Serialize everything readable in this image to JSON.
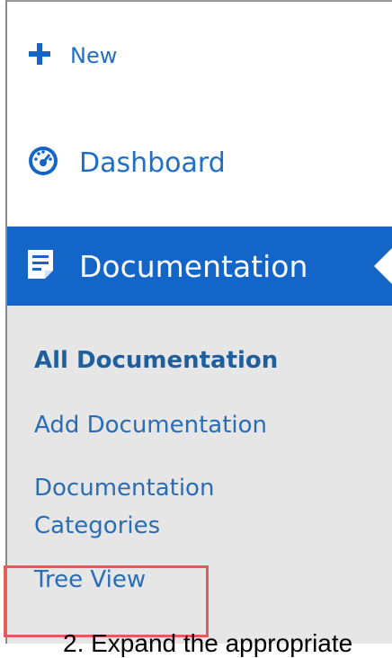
{
  "sidebar": {
    "new_label": "New",
    "dashboard_label": "Dashboard",
    "documentation_label": "Documentation",
    "submenu": [
      {
        "label": "All Documentation"
      },
      {
        "label": "Add Documentation"
      },
      {
        "label": "Documentation Categories"
      },
      {
        "label": "Tree View"
      }
    ]
  },
  "caption": {
    "text": "2. Expand the appropriate"
  },
  "icons": {
    "new": "plus-icon",
    "dashboard": "dashboard-gauge-icon",
    "documentation": "document-icon"
  },
  "colors": {
    "accent": "#1366c8",
    "submenu_bg": "#e6e6e6",
    "highlight": "#e65a5a"
  }
}
